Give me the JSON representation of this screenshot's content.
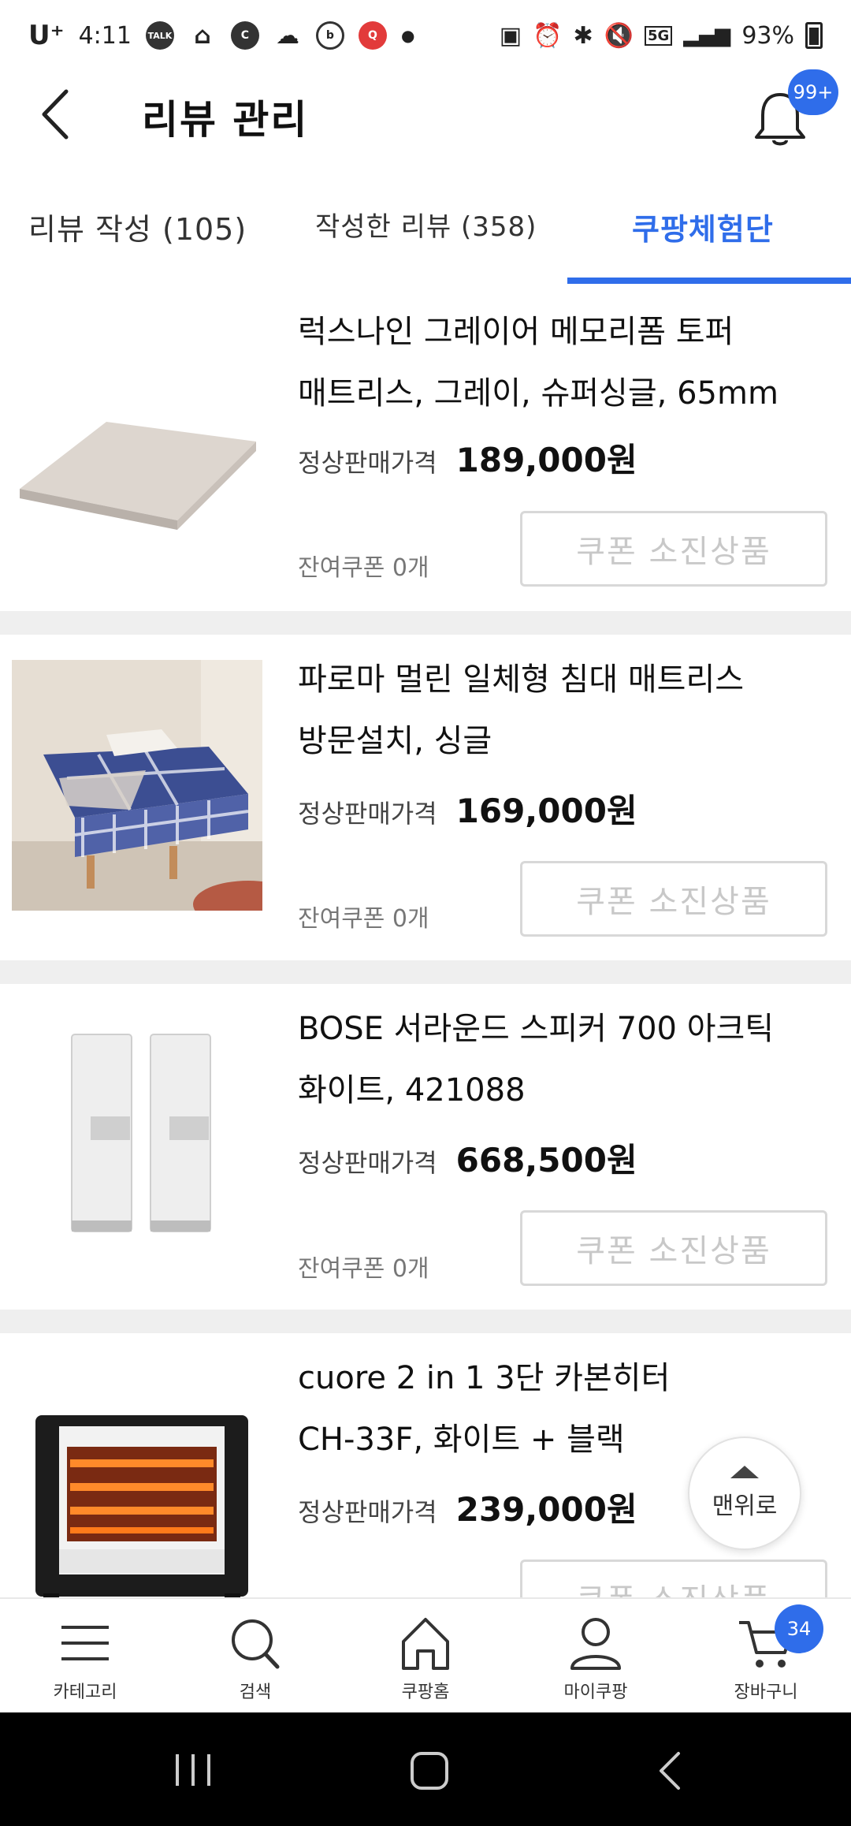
{
  "status_bar": {
    "carrier": "U⁺",
    "time": "4:11",
    "apps": [
      "TALK",
      "⌂",
      "C",
      "☁",
      "b",
      "Q"
    ],
    "network": "5G",
    "battery": "93%"
  },
  "header": {
    "title": "리뷰 관리",
    "notification_badge": "99+"
  },
  "tabs": [
    {
      "label": "리뷰 작성 (105)"
    },
    {
      "label": "작성한 리뷰 (358)"
    },
    {
      "label": "쿠팡체험단"
    }
  ],
  "products": [
    {
      "name_line1": "럭스나인 그레이어 메모리폼 토퍼",
      "name_line2": "매트리스, 그레이, 슈퍼싱글, 65mm",
      "price_label": "정상판매가격",
      "price": "189,000원",
      "coupons_left": "잔여쿠폰 0개",
      "button": "쿠폰 소진상품"
    },
    {
      "name_line1": "파로마 멀린 일체형 침대 매트리스",
      "name_line2": "방문설치, 싱글",
      "price_label": "정상판매가격",
      "price": "169,000원",
      "coupons_left": "잔여쿠폰 0개",
      "button": "쿠폰 소진상품"
    },
    {
      "name_line1": "BOSE 서라운드 스피커 700 아크틱",
      "name_line2": "화이트, 421088",
      "price_label": "정상판매가격",
      "price": "668,500원",
      "coupons_left": "잔여쿠폰 0개",
      "button": "쿠폰 소진상품"
    },
    {
      "name_line1": "cuore 2 in 1 3단 카본히터",
      "name_line2": "CH-33F, 화이트 + 블랙",
      "price_label": "정상판매가격",
      "price": "239,000원",
      "coupons_left": "",
      "button": "쿠폰 소진상품"
    }
  ],
  "scroll_top": {
    "label": "맨위로"
  },
  "bottom_nav": [
    {
      "label": "카테고리",
      "icon": "menu-icon"
    },
    {
      "label": "검색",
      "icon": "search-icon"
    },
    {
      "label": "쿠팡홈",
      "icon": "home-icon"
    },
    {
      "label": "마이쿠팡",
      "icon": "person-icon"
    },
    {
      "label": "장바구니",
      "icon": "cart-icon"
    }
  ],
  "cart_badge": "34",
  "colors": {
    "accent": "#2f6dea",
    "separator": "#efefef",
    "disabled": "#c8c8c8"
  }
}
